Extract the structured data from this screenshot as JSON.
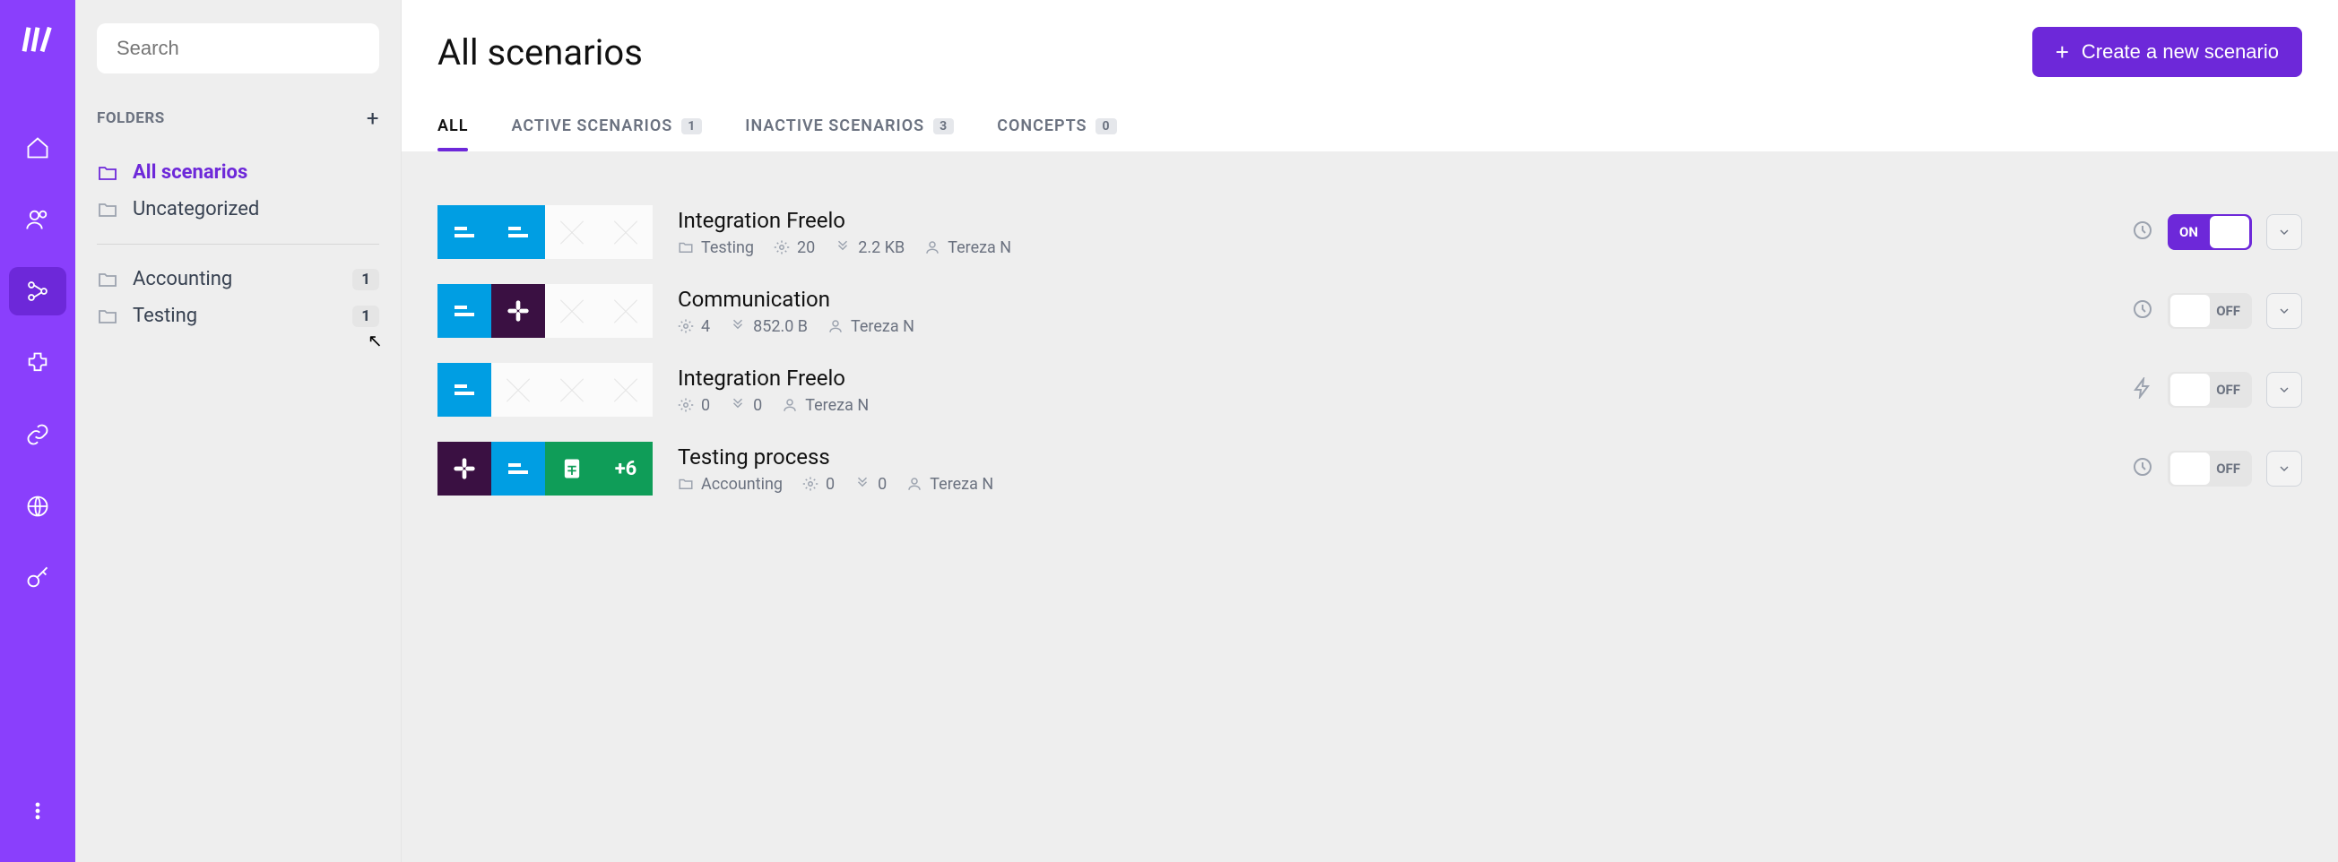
{
  "search": {
    "placeholder": "Search"
  },
  "sidebar": {
    "folders_label": "FOLDERS",
    "items_top": [
      {
        "label": "All scenarios"
      },
      {
        "label": "Uncategorized"
      }
    ],
    "items_bottom": [
      {
        "label": "Accounting",
        "count": "1"
      },
      {
        "label": "Testing",
        "count": "1"
      }
    ]
  },
  "header": {
    "title": "All scenarios",
    "create_label": "Create a new scenario"
  },
  "tabs": {
    "all": "ALL",
    "active": "ACTIVE SCENARIOS",
    "active_count": "1",
    "inactive": "INACTIVE SCENARIOS",
    "inactive_count": "3",
    "concepts": "CONCEPTS",
    "concepts_count": "0"
  },
  "toggles": {
    "on": "ON",
    "off": "OFF"
  },
  "scenarios": [
    {
      "name": "Integration Freelo",
      "folder": "Testing",
      "ops": "20",
      "size": "2.2 KB",
      "user": "Tereza N",
      "state": "on",
      "icon": "clock",
      "apps": [
        "blue",
        "blue",
        "ph",
        "ph"
      ]
    },
    {
      "name": "Communication",
      "folder": "",
      "ops": "4",
      "size": "852.0 B",
      "user": "Tereza N",
      "state": "off",
      "icon": "clock",
      "apps": [
        "blue",
        "dark",
        "ph",
        "ph"
      ]
    },
    {
      "name": "Integration Freelo",
      "folder": "",
      "ops": "0",
      "size": "0",
      "user": "Tereza N",
      "state": "off",
      "icon": "bolt",
      "apps": [
        "blue",
        "ph",
        "ph",
        "ph"
      ]
    },
    {
      "name": "Testing process",
      "folder": "Accounting",
      "ops": "0",
      "size": "0",
      "user": "Tereza N",
      "state": "off",
      "icon": "clock",
      "apps": [
        "dark",
        "blue",
        "green",
        "more"
      ],
      "more": "+6"
    }
  ]
}
